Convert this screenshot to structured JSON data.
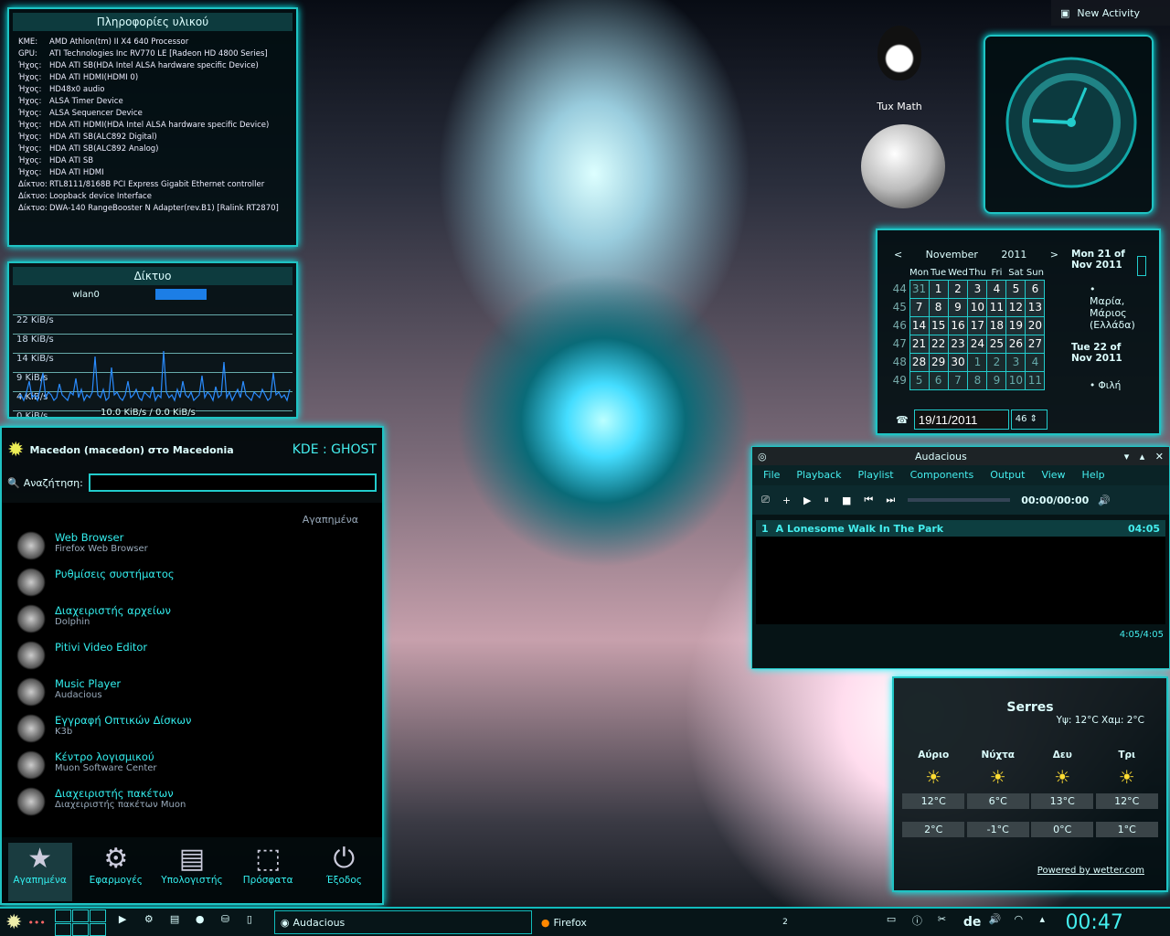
{
  "hardware": {
    "title": "Πληροφορίες υλικού",
    "rows": [
      {
        "k": "ΚΜΕ:",
        "v": "AMD Athlon(tm) II X4 640 Processor"
      },
      {
        "k": "GPU:",
        "v": "ATI Technologies Inc RV770 LE [Radeon HD 4800 Series]"
      },
      {
        "k": "Ήχος:",
        "v": "HDA ATI SB(HDA Intel ALSA hardware specific Device)"
      },
      {
        "k": "Ήχος:",
        "v": "HDA ATI HDMI(HDMI 0)"
      },
      {
        "k": "Ήχος:",
        "v": "HD48x0 audio"
      },
      {
        "k": "Ήχος:",
        "v": "ALSA Timer Device"
      },
      {
        "k": "Ήχος:",
        "v": "ALSA Sequencer Device"
      },
      {
        "k": "Ήχος:",
        "v": "HDA ATI HDMI(HDA Intel ALSA hardware specific Device)"
      },
      {
        "k": "Ήχος:",
        "v": "HDA ATI SB(ALC892 Digital)"
      },
      {
        "k": "Ήχος:",
        "v": "HDA ATI SB(ALC892 Analog)"
      },
      {
        "k": "Ήχος:",
        "v": "HDA ATI SB"
      },
      {
        "k": "Ήχος:",
        "v": "HDA ATI HDMI"
      },
      {
        "k": "Δίκτυο:",
        "v": "RTL8111/8168B PCI Express Gigabit Ethernet controller"
      },
      {
        "k": "Δίκτυο:",
        "v": "Loopback device Interface"
      },
      {
        "k": "Δίκτυο:",
        "v": "DWA-140 RangeBooster N Adapter(rev.B1) [Ralink RT2870]"
      }
    ]
  },
  "network": {
    "title": "Δίκτυο",
    "iface": "wlan0",
    "lines": [
      "22 KiB/s",
      "18 KiB/s",
      "14 KiB/s",
      "9 KiB/s",
      "4 KiB/s",
      "0 KiB/s"
    ],
    "readout": "10.0 KiB/s / 0.0 KiB/s",
    "wave": [
      3,
      4,
      2,
      5,
      9,
      3,
      4,
      2,
      6,
      12,
      3,
      5,
      4,
      2,
      3,
      8,
      4,
      3,
      2,
      5,
      4,
      10,
      3,
      6,
      2,
      4,
      3,
      5,
      18,
      4,
      3,
      6,
      2,
      3,
      14,
      4,
      5,
      3,
      2,
      4,
      9,
      3,
      4,
      6,
      3,
      2,
      5,
      4,
      3,
      7,
      2,
      4,
      3,
      20,
      5,
      3,
      4,
      2,
      6,
      3,
      9,
      4,
      3,
      5,
      2,
      3,
      4,
      11,
      3,
      5,
      4,
      2,
      7,
      3,
      4,
      16,
      3,
      5,
      2,
      4,
      6,
      3,
      9,
      4,
      3,
      2,
      5,
      4,
      3,
      6,
      4,
      2,
      3,
      12,
      4,
      5,
      3,
      4,
      2,
      6
    ]
  },
  "launcher": {
    "user": "Macedon (macedon) στο Macedonia",
    "brand": "KDE : GHOST",
    "search_label": "Αναζήτηση:",
    "search_value": "",
    "section": "Αγαπημένα",
    "items": [
      {
        "t": "Web Browser",
        "s": "Firefox Web Browser",
        "icon": "web-browser-icon"
      },
      {
        "t": "Ρυθμίσεις συστήματος",
        "s": "",
        "icon": "tools-icon"
      },
      {
        "t": "Διαχειριστής αρχείων",
        "s": "Dolphin",
        "icon": "file-manager-icon"
      },
      {
        "t": "Pitivi Video Editor",
        "s": "",
        "icon": "video-editor-icon"
      },
      {
        "t": "Music Player",
        "s": "Audacious",
        "icon": "music-player-icon"
      },
      {
        "t": "Εγγραφή Οπτικών Δίσκων",
        "s": "K3b",
        "icon": "disc-burner-icon"
      },
      {
        "t": "Κέντρο λογισμικού",
        "s": "Muon Software Center",
        "icon": "software-center-icon"
      },
      {
        "t": "Διαχειριστής πακέτων",
        "s": "Διαχειριστής πακέτων Muon",
        "icon": "package-manager-icon"
      }
    ],
    "tabs": [
      "Αγαπημένα",
      "Εφαρμογές",
      "Υπολογιστής",
      "Πρόσφατα",
      "Έξοδος"
    ]
  },
  "desktop": {
    "tux_label": "Tux Math",
    "activity": "New Activity"
  },
  "calendar": {
    "month": "November",
    "year": "2011",
    "days": [
      "Mon",
      "Tue",
      "Wed",
      "Thu",
      "Fri",
      "Sat",
      "Sun"
    ],
    "weeks": [
      {
        "n": "44",
        "d": [
          "31",
          "1",
          "2",
          "3",
          "4",
          "5",
          "6"
        ]
      },
      {
        "n": "45",
        "d": [
          "7",
          "8",
          "9",
          "10",
          "11",
          "12",
          "13"
        ]
      },
      {
        "n": "46",
        "d": [
          "14",
          "15",
          "16",
          "17",
          "18",
          "19",
          "20"
        ]
      },
      {
        "n": "47",
        "d": [
          "21",
          "22",
          "23",
          "24",
          "25",
          "26",
          "27"
        ]
      },
      {
        "n": "48",
        "d": [
          "28",
          "29",
          "30",
          "1",
          "2",
          "3",
          "4"
        ]
      },
      {
        "n": "49",
        "d": [
          "5",
          "6",
          "7",
          "8",
          "9",
          "10",
          "11"
        ]
      }
    ],
    "event_day1": "Mon 21 of Nov 2011",
    "event1": "• Μαρία, Μάριος (Ελλάδα)",
    "event_day2": "Tue 22 of Nov 2011",
    "event2": "• Φιλή",
    "date_field": "19/11/2011",
    "week_field": "46"
  },
  "audacious": {
    "title": "Audacious",
    "menu": [
      "File",
      "Playback",
      "Playlist",
      "Components",
      "Output",
      "View",
      "Help"
    ],
    "time": "00:00/00:00",
    "track_no": "1",
    "track": "A Lonesome Walk In The Park",
    "track_len": "04:05",
    "status": "4:05/4:05"
  },
  "weather": {
    "city": "Serres",
    "hilo": "Υψ: 12°C Χαμ: 2°C",
    "cols": [
      {
        "d": "Αύριο",
        "h": "12°C",
        "l": "2°C"
      },
      {
        "d": "Νύχτα",
        "h": "6°C",
        "l": "-1°C"
      },
      {
        "d": "Δευ",
        "h": "13°C",
        "l": "0°C"
      },
      {
        "d": "Τρι",
        "h": "12°C",
        "l": "1°C"
      }
    ],
    "powered": "Powered by wetter.com"
  },
  "taskbar": {
    "task1": "Audacious",
    "task2": "Firefox",
    "pager_count": "2",
    "lang": "de",
    "clock": "00:47"
  }
}
